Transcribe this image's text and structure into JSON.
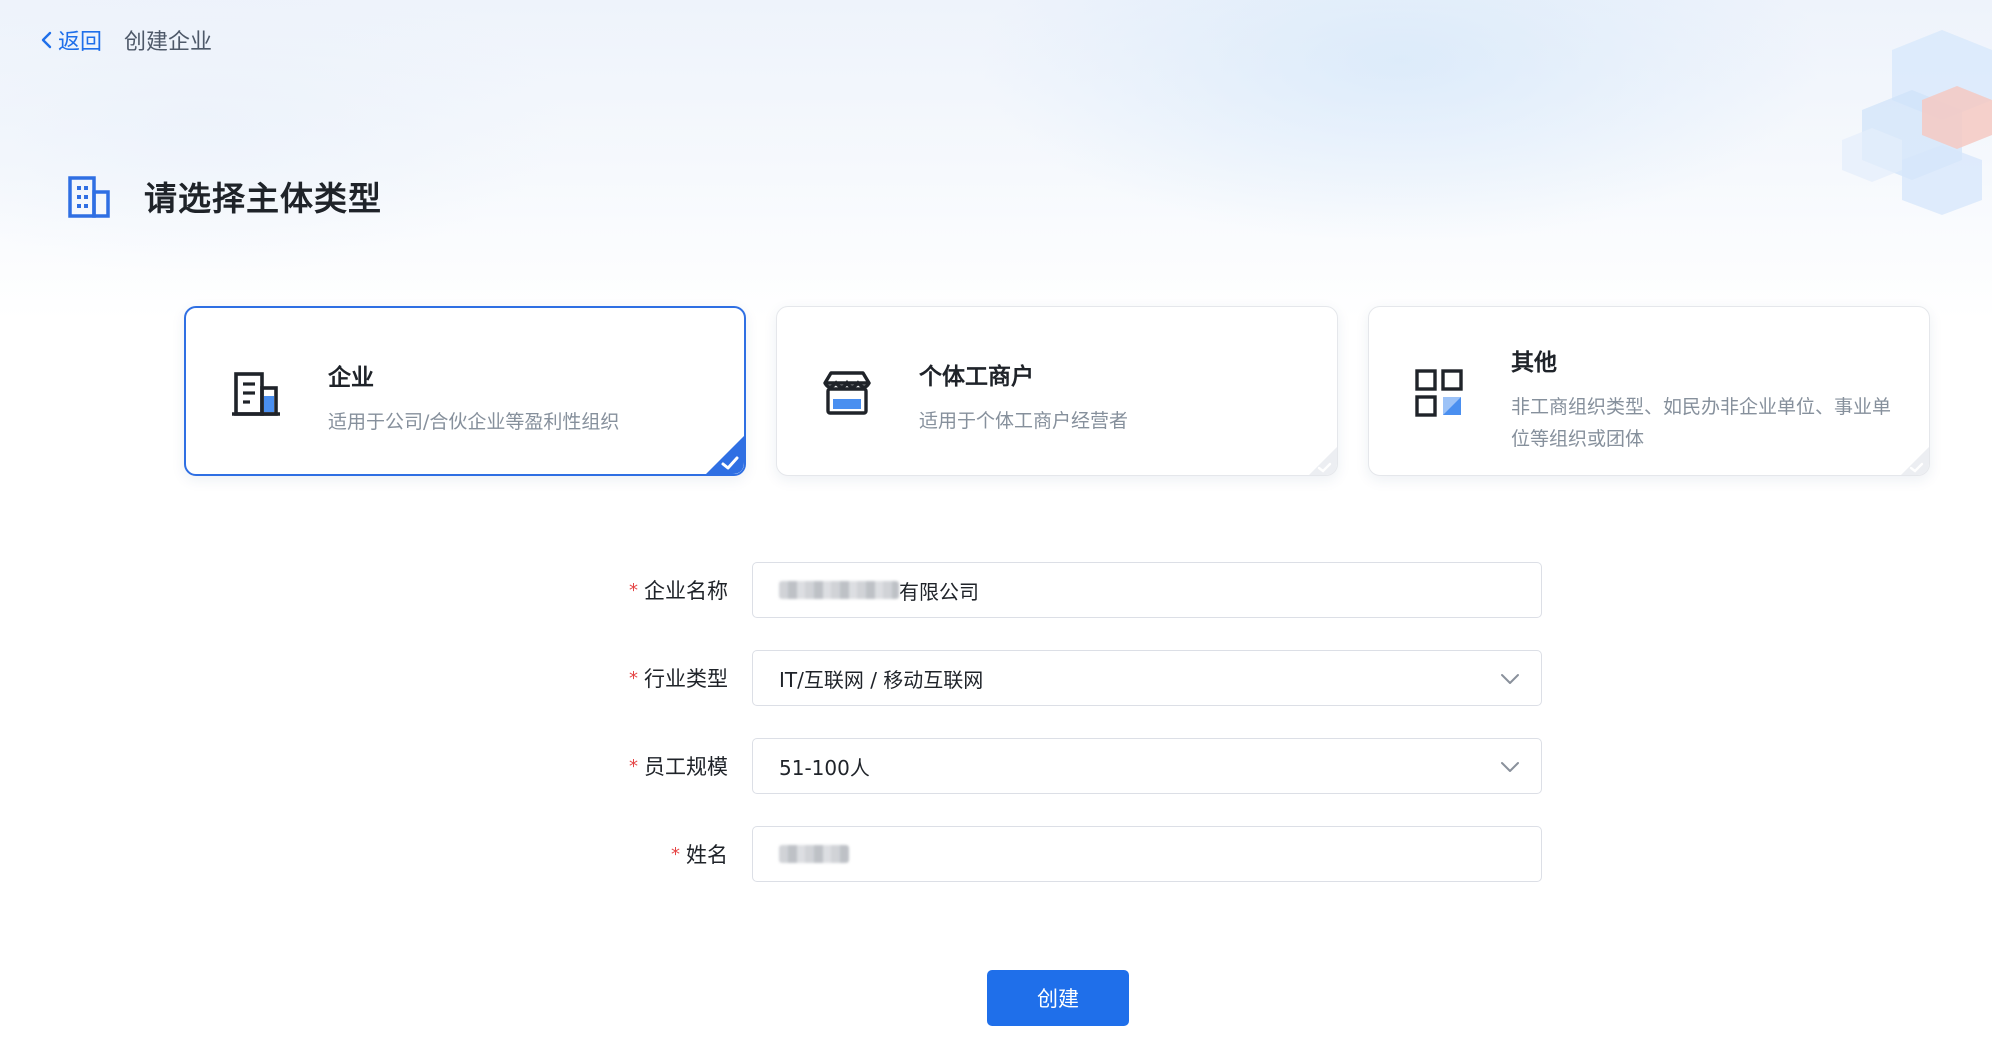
{
  "header": {
    "back_label": "返回",
    "title": "创建企业"
  },
  "section": {
    "title": "请选择主体类型"
  },
  "cards": [
    {
      "title": "企业",
      "desc": "适用于公司/合伙企业等盈利性组织",
      "selected": true
    },
    {
      "title": "个体工商户",
      "desc": "适用于个体工商户经营者",
      "selected": false
    },
    {
      "title": "其他",
      "desc": "非工商组织类型、如民办非企业单位、事业单位等组织或团体",
      "selected": false
    }
  ],
  "form": {
    "company_name": {
      "label": "企业名称",
      "value_suffix": "有限公司"
    },
    "industry": {
      "label": "行业类型",
      "value": "IT/互联网 / 移动互联网"
    },
    "staff_size": {
      "label": "员工规模",
      "value": "51-100人"
    },
    "name": {
      "label": "姓名",
      "value": ""
    }
  },
  "actions": {
    "create_label": "创建"
  },
  "colors": {
    "accent": "#1f6fea",
    "required": "#e54545"
  }
}
